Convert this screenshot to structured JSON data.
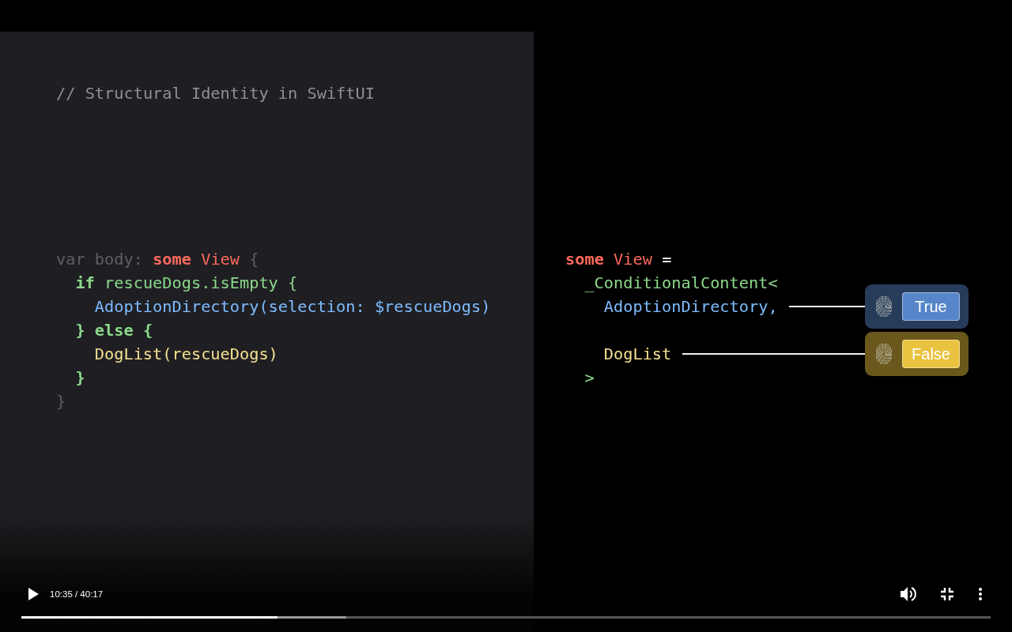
{
  "slide": {
    "comment": "// Structural Identity in SwiftUI",
    "code": [
      {
        "tokens": [
          {
            "text": "var",
            "kind": "dim"
          },
          {
            "text": "body:",
            "kind": "dim"
          },
          {
            "text": "some",
            "kind": "keyword"
          },
          {
            "text": "View",
            "kind": "type"
          },
          {
            "text": "{",
            "kind": "dim"
          }
        ],
        "children": [
          {
            "tokens": [
              {
                "text": "if",
                "kind": "control"
              },
              {
                "text": "rescueDogs.isEmpty",
                "kind": "green"
              },
              {
                "text": "{",
                "kind": "green"
              }
            ],
            "children": [
              {
                "tokens": [
                  {
                    "text": "AdoptionDirectory(selection: $rescueDogs)",
                    "kind": "blue"
                  }
                ]
              }
            ]
          },
          {
            "tokens": [
              {
                "text": "}",
                "kind": "control"
              },
              {
                "text": "else",
                "kind": "control"
              },
              {
                "text": "{",
                "kind": "control"
              }
            ],
            "children": [
              {
                "tokens": [
                  {
                    "text": "DogList(rescueDogs)",
                    "kind": "yellow"
                  }
                ]
              }
            ]
          },
          {
            "tokens": [
              {
                "text": "}",
                "kind": "control"
              }
            ]
          }
        ]
      },
      {
        "tokens": [
          {
            "text": "}",
            "kind": "dim"
          }
        ]
      }
    ],
    "type_tree": [
      {
        "tokens": [
          {
            "text": "some",
            "kind": "keyword"
          },
          {
            "text": "View",
            "kind": "type"
          },
          {
            "text": "=",
            "kind": "plain"
          }
        ],
        "children": [
          {
            "tokens": [
              {
                "text": "_ConditionalContent<",
                "kind": "green"
              }
            ],
            "children": [
              {
                "tokens": [
                  {
                    "text": "AdoptionDirectory,",
                    "kind": "blue"
                  }
                ],
                "badge": {
                  "label": "True",
                  "color": "#5686c9"
                }
              },
              {
                "tokens": [
                  {
                    "text": "DogList",
                    "kind": "yellow"
                  }
                ],
                "badge": {
                  "label": "False",
                  "color": "#e9c23f"
                }
              }
            ]
          },
          {
            "tokens": [
              {
                "text": ">",
                "kind": "green"
              }
            ]
          }
        ]
      }
    ]
  },
  "player": {
    "playing": false,
    "time": "10:35 / 40:17",
    "progress": {
      "level": 0.264
    },
    "buffered": {
      "level": 0.335
    }
  }
}
